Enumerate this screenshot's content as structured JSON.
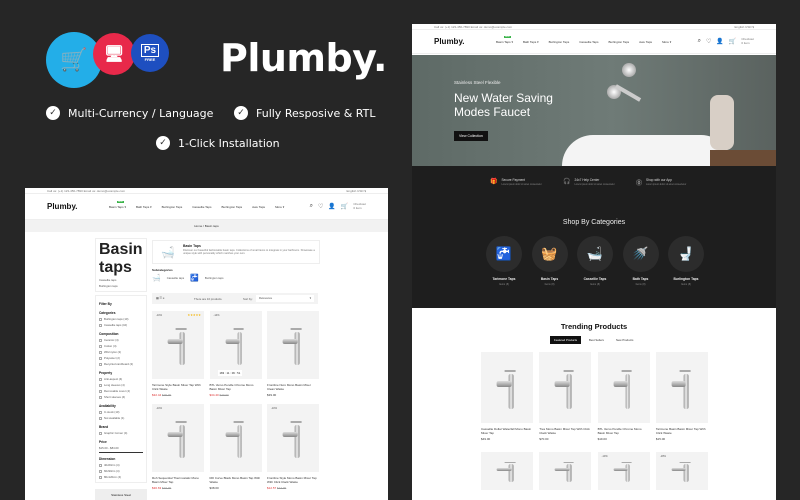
{
  "promo": {
    "title": "Plumby.",
    "badges": [
      {
        "icon": "opencart-cart-icon",
        "color": "#23aee8"
      },
      {
        "icon": "responsive-devices-icon",
        "color": "#e8294a"
      },
      {
        "icon": "photoshop-icon",
        "label": "Ps",
        "sub": "FREE",
        "color": "#1e4fc0"
      }
    ],
    "features": [
      "Multi-Currency / Language",
      "Fully Resposive & RTL",
      "1-Click Installation"
    ]
  },
  "header": {
    "topbar_left": "Call us: (+1) 123-456-7890    Email us: demo@example.com",
    "topbar_right": "English   USD $",
    "logo": "Plumby.",
    "nav": [
      "Basin Taps",
      "Bath Taps",
      "Burlington Taps",
      "Cassellie Taps",
      "Burlington Taps",
      "Awe Taps",
      "More"
    ],
    "new_badge": "NEW",
    "cart_label": "Checkout",
    "cart_sub": "0 item"
  },
  "hero": {
    "kicker": "Stainless Steel Flexible",
    "title_line1": "New Water Saving",
    "title_line2": "Modes Faucet",
    "button": "View Collection"
  },
  "services": [
    {
      "icon": "gift-icon",
      "title": "Secure Payment",
      "text": "Lorem ipsum dolor sit amet consectetur"
    },
    {
      "icon": "headset-icon",
      "title": "24x7 Help Center",
      "text": "Lorem ipsum dolor sit amet consectetur"
    },
    {
      "icon": "app-icon",
      "title": "Shop with our App",
      "text": "Lorem ipsum dolor sit amet consectetur"
    }
  ],
  "categories": {
    "title": "Shop By Categories",
    "items": [
      {
        "label": "Tarimone Taps",
        "count": "Items (8)",
        "icon": "faucet-icon"
      },
      {
        "label": "Basin Taps",
        "count": "Items (8)",
        "icon": "towel-icon"
      },
      {
        "label": "Cassellie Taps",
        "count": "Items (8)",
        "icon": "bathtub-icon"
      },
      {
        "label": "Bath Taps",
        "count": "Items (8)",
        "icon": "shower-icon"
      },
      {
        "label": "Burlington Taps",
        "count": "Items (8)",
        "icon": "toilet-icon"
      }
    ]
  },
  "trending": {
    "title": "Trending Products",
    "tabs": [
      "Featured Products",
      "Best Sellers",
      "New Products"
    ],
    "products": [
      {
        "name": "Cassellie Dollar Waterfall Mono Basin Mixer Tap",
        "price": "$49.00"
      },
      {
        "name": "Tres Mono Basin Mixer Tap With Click Clack Waste",
        "price": "$70.00"
      },
      {
        "name": "BTL Verso Pendle Chrome Mono Basin Mixer Tap",
        "price": "$19.00"
      },
      {
        "name": "Tarimone Basin Basin Mixer Tap With Click Waste",
        "price": "$15.00"
      },
      {
        "name": "",
        "price": ""
      },
      {
        "name": "",
        "price": ""
      },
      {
        "name": "",
        "price": "",
        "tag": "-10%"
      },
      {
        "name": "",
        "price": "",
        "tag": "-18%"
      }
    ]
  },
  "category_page": {
    "breadcrumb": "Home / Basin taps",
    "sidebar": {
      "title": "Basin taps",
      "links": [
        "Cassellie taps",
        "Burlington taps"
      ],
      "filter_title": "Filter By",
      "groups": [
        {
          "title": "Categories",
          "options": [
            "Burlington taps (10)",
            "Cassellie taps (10)"
          ]
        },
        {
          "title": "Composition",
          "options": [
            "Ceramic (4)",
            "Cotton (4)",
            "Wild nylon (2)",
            "Polyester (2)",
            "Recycled cardboard (2)"
          ]
        },
        {
          "title": "Property",
          "options": [
            "Anti-aspect (4)",
            "Long sleeves (4)",
            "Removable cover (4)",
            "Short sleeves (4)"
          ]
        },
        {
          "title": "Availability",
          "options": [
            "In stock (10)",
            "Not available (1)"
          ]
        },
        {
          "title": "Brand",
          "options": [
            "Graphic Corner (4)"
          ]
        },
        {
          "title": "Price",
          "options": [
            "$15.00 - $84.00"
          ]
        },
        {
          "title": "Dimension",
          "options": [
            "40x60cm (4)",
            "60x90cm (4)",
            "80x120cm (4)"
          ]
        }
      ],
      "banner": "Stainless Steel"
    },
    "heading": "Basin Taps",
    "description": "Discover our beautiful fashionable basin taps. Collections of small items to integrate in your bathroom. Showcase a unique style with personality which matches your own.",
    "subcategories_title": "Subcategories",
    "subcategories": [
      "Cassellie taps",
      "Burlington taps"
    ],
    "toolbar": {
      "count": "There are 10 products.",
      "sort_label": "Sort by:",
      "sort_value": "Relevance"
    },
    "products": [
      {
        "name": "Tarimone Style Basin Mixer Tap With Click Waste",
        "price": "$32.44",
        "old": "$36.00",
        "tag": "-10%",
        "rating": 5
      },
      {
        "name": "BTL Verso Pendle Chrome Mono Basin Mixer Tap",
        "price": "$34.40",
        "old": "$40.00",
        "tag": "-14%",
        "countdown": "183 : 11 : 06 : 51"
      },
      {
        "name": "Frontline Nuro Mono Basin Mixer Clean Waste",
        "price": "$39.00",
        "old": ""
      },
      {
        "name": "Roh Sequential Thermostatic Mono Basin Mixer Tap",
        "price": "$30.63",
        "old": "$34.00",
        "tag": "-10%"
      },
      {
        "name": "Rift Curve Black Mono Basin Tap With Waste",
        "price": "$38.00",
        "old": "",
        "tag": ""
      },
      {
        "name": "Frontline Style Mono Basin Mixer Tap With Click Clack Waste",
        "price": "$12.57",
        "old": "$14.00",
        "tag": "-10%"
      }
    ]
  }
}
